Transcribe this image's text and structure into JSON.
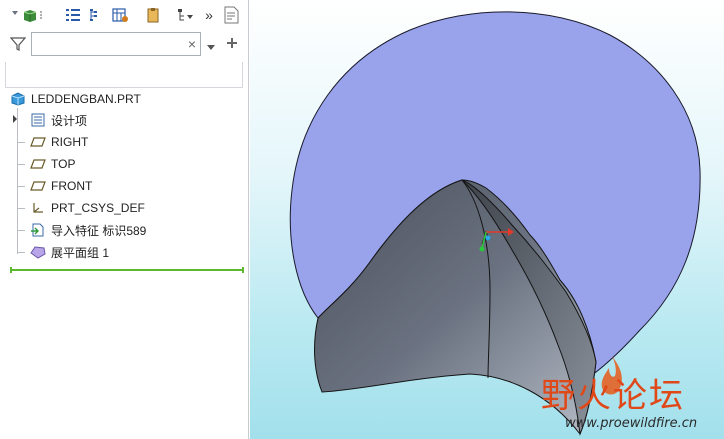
{
  "filter": {
    "search_value": "",
    "clear_glyph": "×"
  },
  "toolbar": {
    "icons": [
      "model-icon",
      "show-tree-icon",
      "tree-columns-icon",
      "tree-filters-icon",
      "settings-icon",
      "more-icon",
      "notes-icon"
    ],
    "more_glyph": "»"
  },
  "tree": {
    "root": "LEDDENGBAN.PRT",
    "items": [
      {
        "label": "设计项",
        "icon": "design-items-icon"
      },
      {
        "label": "RIGHT",
        "icon": "datum-plane-icon"
      },
      {
        "label": "TOP",
        "icon": "datum-plane-icon"
      },
      {
        "label": "FRONT",
        "icon": "datum-plane-icon"
      },
      {
        "label": "PRT_CSYS_DEF",
        "icon": "coordinate-system-icon"
      },
      {
        "label": "导入特征 标识589",
        "icon": "import-feature-icon"
      },
      {
        "label": "展平面组 1",
        "icon": "flatten-quilt-icon"
      }
    ]
  },
  "watermark": {
    "text": "野火论坛",
    "url": "www.proewildfire.cn"
  },
  "colors": {
    "flat_surface": "#98a3ec",
    "shell_dark": "#5b626d",
    "shell_light": "#a8b0bb",
    "accent_green": "#5cb82f"
  }
}
